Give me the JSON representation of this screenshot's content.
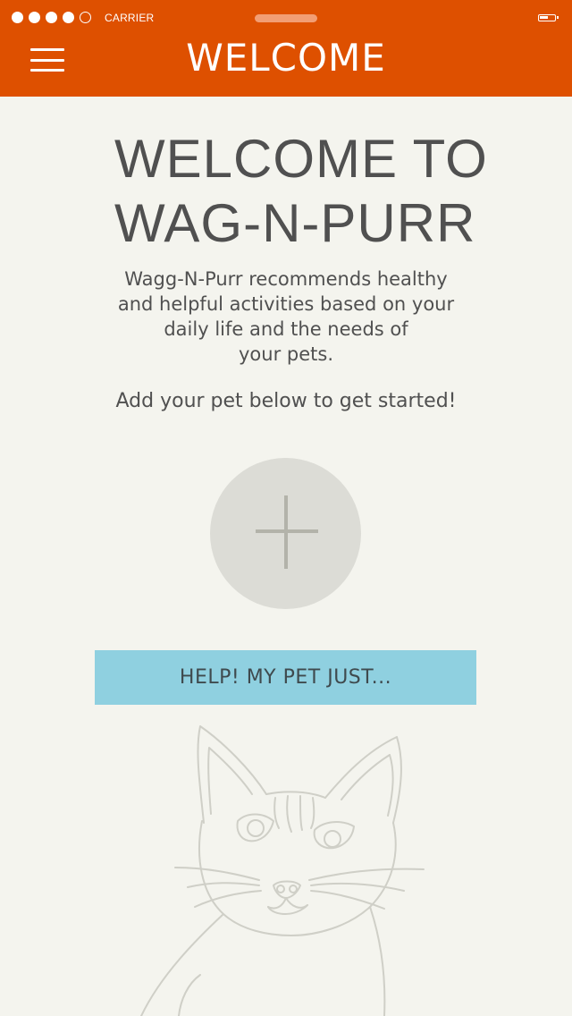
{
  "status_bar": {
    "signal_dots": 5,
    "signal_filled": 4,
    "carrier": "CARRIER"
  },
  "nav": {
    "title": "WELCOME"
  },
  "main": {
    "headline_line1": "WELCOME TO",
    "headline_line2": "WAG-N-PURR",
    "description_lines": [
      "Wagg-N-Purr recommends healthy",
      "and helpful activities based on your",
      "daily life and the needs of",
      "your pets."
    ],
    "call_to_action": "Add your pet below to get started!",
    "help_button_label": "HELP! MY PET JUST..."
  },
  "icons": {
    "menu": "hamburger-menu-icon",
    "add": "plus-icon",
    "illustration": "cat-illustration"
  },
  "colors": {
    "header": "#de5000",
    "background": "#f4f4ee",
    "help_button": "#8fd0e0",
    "add_circle": "#dcdcd6"
  }
}
